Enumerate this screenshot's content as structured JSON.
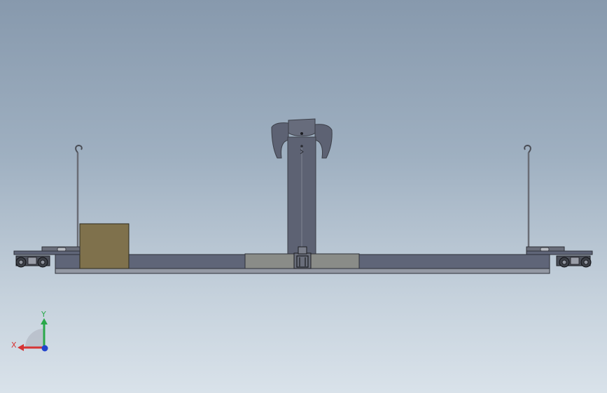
{
  "scene": {
    "background_top": "#8799ad",
    "background_bottom": "#d9e2ea",
    "part_colors": {
      "beam": "#5f6578",
      "beam_top": "#6f7588",
      "center_plate": "#8a8c88",
      "mast": "#5d6273",
      "block": "#7f714c",
      "hook_rod": "#6a6d76",
      "wheel": "#3c3f46"
    }
  },
  "triad": {
    "x_label": "X",
    "y_label": "Y",
    "x_color": "#d63333",
    "y_color": "#2aa84a",
    "z_color": "#2244cc"
  }
}
